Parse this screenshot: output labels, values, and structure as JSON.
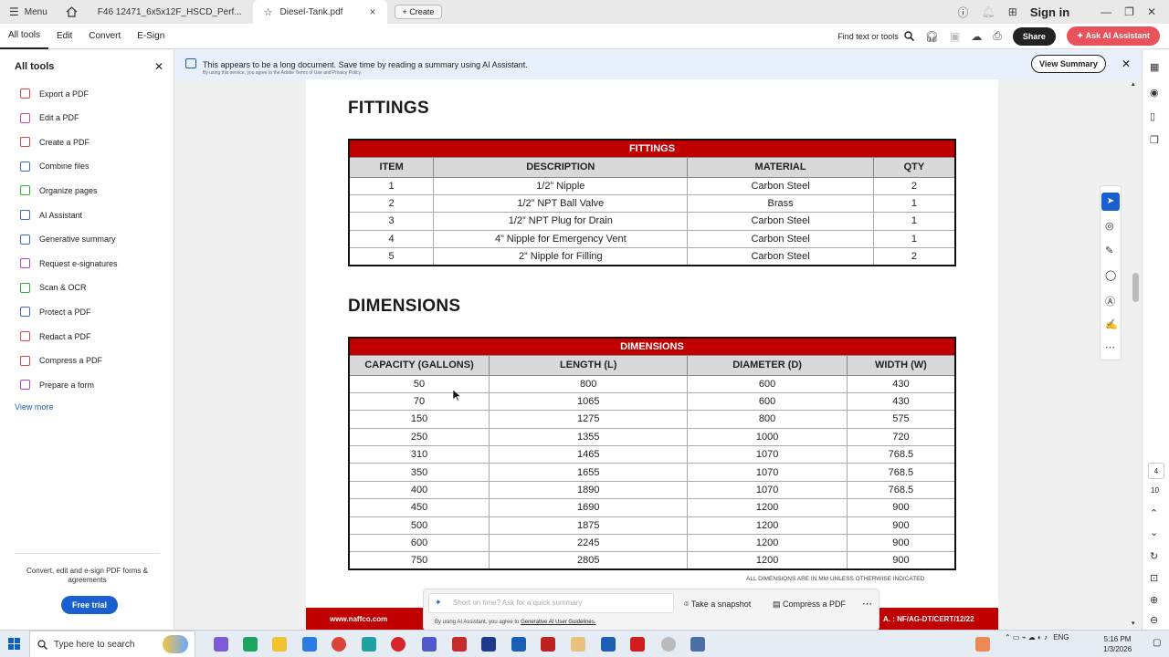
{
  "browser": {
    "menu_label": "Menu",
    "tabs": [
      {
        "label": "F46 12471_6x5x12F_HSCD_Perf..."
      },
      {
        "label": "Diesel-Tank.pdf"
      }
    ],
    "new_tab_label": "Create",
    "sign_in": "Sign in"
  },
  "toolbar": {
    "menus": [
      "All tools",
      "Edit",
      "Convert",
      "E-Sign"
    ],
    "find_label": "Find text or tools",
    "share_label": "Share",
    "ai_assistant_label": "Ask AI Assistant"
  },
  "left_panel": {
    "title": "All tools",
    "items": [
      {
        "label": "Export a PDF",
        "color": "#d44"
      },
      {
        "label": "Edit a PDF",
        "color": "#c4a"
      },
      {
        "label": "Create a PDF",
        "color": "#d44"
      },
      {
        "label": "Combine files",
        "color": "#46c"
      },
      {
        "label": "Organize pages",
        "color": "#3a3"
      },
      {
        "label": "AI Assistant",
        "color": "#46c"
      },
      {
        "label": "Generative summary",
        "color": "#46c"
      },
      {
        "label": "Request e-signatures",
        "color": "#a4c"
      },
      {
        "label": "Scan & OCR",
        "color": "#3a3"
      },
      {
        "label": "Protect a PDF",
        "color": "#46c"
      },
      {
        "label": "Redact a PDF",
        "color": "#d44"
      },
      {
        "label": "Compress a PDF",
        "color": "#d44"
      },
      {
        "label": "Prepare a form",
        "color": "#a4c"
      }
    ],
    "view_more": "View more",
    "promo_text": "Convert, edit and e-sign PDF forms & agreements",
    "free_trial": "Free trial"
  },
  "banner": {
    "text": "This appears to be a long document. Save time by reading a summary using AI Assistant.",
    "subtext": "By using this service, you agree to the Adobe Terms of Use and Privacy Policy.",
    "view_summary": "View Summary"
  },
  "document": {
    "fittings_title": "FITTINGS",
    "fittings_table": {
      "caption": "FITTINGS",
      "headers": [
        "ITEM",
        "DESCRIPTION",
        "MATERIAL",
        "QTY"
      ],
      "rows": [
        [
          "1",
          "1/2” Nipple",
          "Carbon Steel",
          "2"
        ],
        [
          "2",
          "1/2” NPT Ball Valve",
          "Brass",
          "1"
        ],
        [
          "3",
          "1/2” NPT Plug for Drain",
          "Carbon Steel",
          "1"
        ],
        [
          "4",
          "4” Nipple for Emergency Vent",
          "Carbon Steel",
          "1"
        ],
        [
          "5",
          "2” Nipple for Filling",
          "Carbon Steel",
          "2"
        ]
      ]
    },
    "dimensions_title": "DIMENSIONS",
    "dimensions_table": {
      "caption": "DIMENSIONS",
      "headers": [
        "CAPACITY (GALLONS)",
        "LENGTH (L)",
        "DIAMETER (D)",
        "WIDTH (W)"
      ],
      "rows": [
        [
          "50",
          "800",
          "600",
          "430"
        ],
        [
          "70",
          "1065",
          "600",
          "430"
        ],
        [
          "150",
          "1275",
          "800",
          "575"
        ],
        [
          "250",
          "1355",
          "1000",
          "720"
        ],
        [
          "310",
          "1465",
          "1070",
          "768.5"
        ],
        [
          "350",
          "1655",
          "1070",
          "768.5"
        ],
        [
          "400",
          "1890",
          "1070",
          "768.5"
        ],
        [
          "450",
          "1690",
          "1200",
          "900"
        ],
        [
          "500",
          "1875",
          "1200",
          "900"
        ],
        [
          "600",
          "2245",
          "1200",
          "900"
        ],
        [
          "750",
          "2805",
          "1200",
          "900"
        ]
      ]
    },
    "dimensions_note": "ALL DIMENSIONS ARE IN MM UNLESS OTHERWISE INDICATED",
    "footer_left": "www.naffco.com",
    "footer_right": "A. : NF/AG-DT/CERT/12/22"
  },
  "ai_bar": {
    "placeholder": "Short on time? Ask for a quick summary",
    "snapshot": "Take a snapshot",
    "compress": "Compress a PDF",
    "note_prefix": "By using AI Assistant, you agree to",
    "note_link": "Generative AI User Guidelines."
  },
  "page_nav": {
    "current": "4",
    "total": "10"
  },
  "taskbar": {
    "search_placeholder": "Type here to search",
    "language": "ENG",
    "time": "5:16 PM",
    "date": "1/3/2026"
  }
}
